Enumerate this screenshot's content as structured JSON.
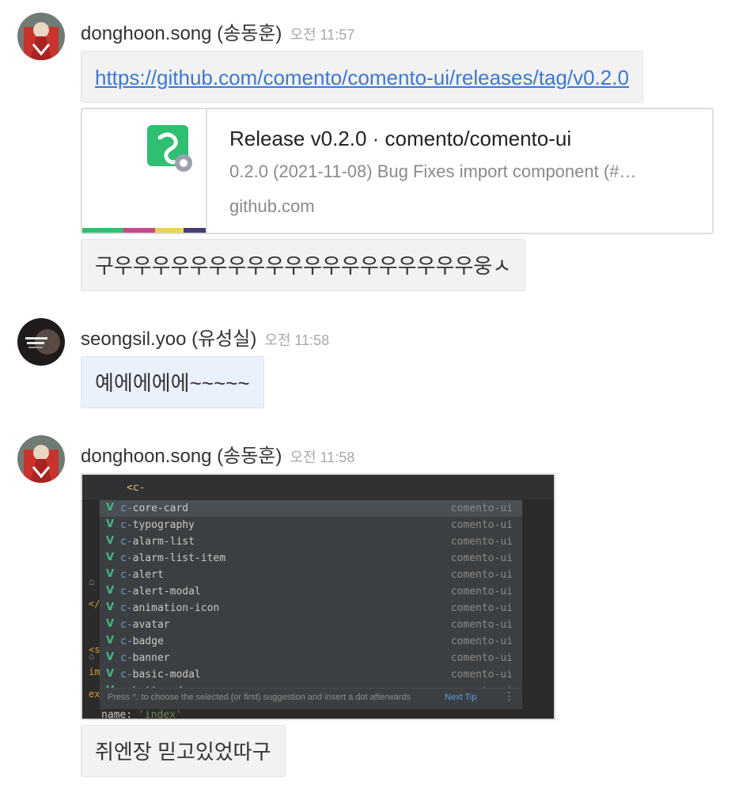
{
  "messages": [
    {
      "author": "donghoon.song (송동훈)",
      "time": "오전 11:57",
      "link": "https://github.com/comento/comento-ui/releases/tag/v0.2.0",
      "preview": {
        "title": "Release v0.2.0 · comento/comento-ui",
        "description": "0.2.0 (2021-11-08) Bug Fixes import component (#…",
        "domain": "github.com"
      },
      "text": "구우우우우우우우우우우우우우우우우우우우웅ㅅ"
    },
    {
      "author": "seongsil.yoo (유성실)",
      "time": "오전 11:58",
      "text": "예에에에에~~~~~"
    },
    {
      "author": "donghoon.song (송동훈)",
      "time": "오전 11:58",
      "text": "쥐엔장 믿고있었따구"
    }
  ],
  "screenshot": {
    "typed": "<c-",
    "prefix": "c-",
    "suggestions": [
      {
        "name": "core-card",
        "source": "comento-ui"
      },
      {
        "name": "typography",
        "source": "comento-ui"
      },
      {
        "name": "alarm-list",
        "source": "comento-ui"
      },
      {
        "name": "alarm-list-item",
        "source": "comento-ui"
      },
      {
        "name": "alert",
        "source": "comento-ui"
      },
      {
        "name": "alert-modal",
        "source": "comento-ui"
      },
      {
        "name": "animation-icon",
        "source": "comento-ui"
      },
      {
        "name": "avatar",
        "source": "comento-ui"
      },
      {
        "name": "badge",
        "source": "comento-ui"
      },
      {
        "name": "banner",
        "source": "comento-ui"
      },
      {
        "name": "basic-modal",
        "source": "comento-ui"
      },
      {
        "name": "bottom-drawer",
        "source": "comento-ui"
      }
    ],
    "hint": "Press ^. to choose the selected (or first) suggestion and insert a dot afterwards",
    "next_tip": "Next Tip",
    "code_key": "name: ",
    "code_value": "'index'"
  },
  "colors": {
    "accent_link": "#3a78d6",
    "own_bubble": "#eaf1fd",
    "vue_green": "#42b883",
    "comento_green": "#2fbf71"
  }
}
